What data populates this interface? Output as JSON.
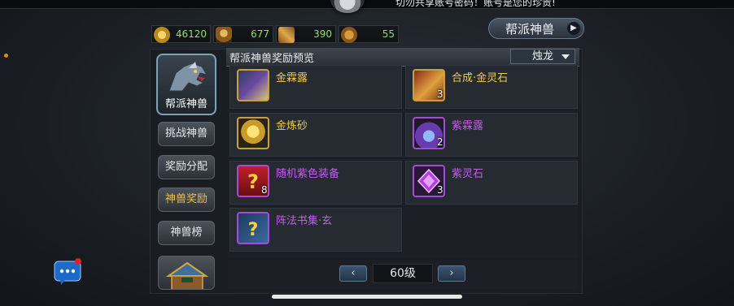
{
  "marquee": "切勿共享账号密码！账号是您的珍贵!",
  "currencies": [
    {
      "icon": "gold-coin-icon",
      "value": "46120"
    },
    {
      "icon": "helmet-token-icon",
      "value": "677"
    },
    {
      "icon": "crossed-swords-icon",
      "value": "390"
    },
    {
      "icon": "scroll-token-icon",
      "value": "55"
    }
  ],
  "title_button": "帮派神兽",
  "side_nav": {
    "main_label": "帮派神兽",
    "items": [
      "挑战神兽",
      "奖励分配",
      "神兽奖励",
      "神兽榜"
    ]
  },
  "panel": {
    "title": "帮派神兽奖励预览",
    "dropdown_value": "烛龙"
  },
  "rewards": [
    {
      "name": "金霖露",
      "qty": "",
      "rarity": "gold",
      "icon": "potion-scroll-icon"
    },
    {
      "name": "合成·金灵石",
      "qty": "3",
      "rarity": "gold",
      "icon": "fusion-scroll-icon"
    },
    {
      "name": "金炼砂",
      "qty": "",
      "rarity": "gold",
      "icon": "gold-sand-icon"
    },
    {
      "name": "紫霖露",
      "qty": "2",
      "rarity": "purple",
      "icon": "purple-potion-icon"
    },
    {
      "name": "随机紫色装备",
      "qty": "8",
      "rarity": "purple",
      "icon": "mystery-equipment-icon"
    },
    {
      "name": "紫灵石",
      "qty": "3",
      "rarity": "purple",
      "icon": "purple-crystal-icon"
    },
    {
      "name": "阵法书集·玄",
      "qty": "",
      "rarity": "purple",
      "icon": "formation-book-icon"
    }
  ],
  "pager": {
    "level": "60级",
    "prev": "‹",
    "next": "›"
  },
  "colors": {
    "gold": "#f3c94a",
    "purple": "#c65bf0",
    "currency_green": "#8ee06a",
    "accent_orange": "#e38a1f"
  }
}
